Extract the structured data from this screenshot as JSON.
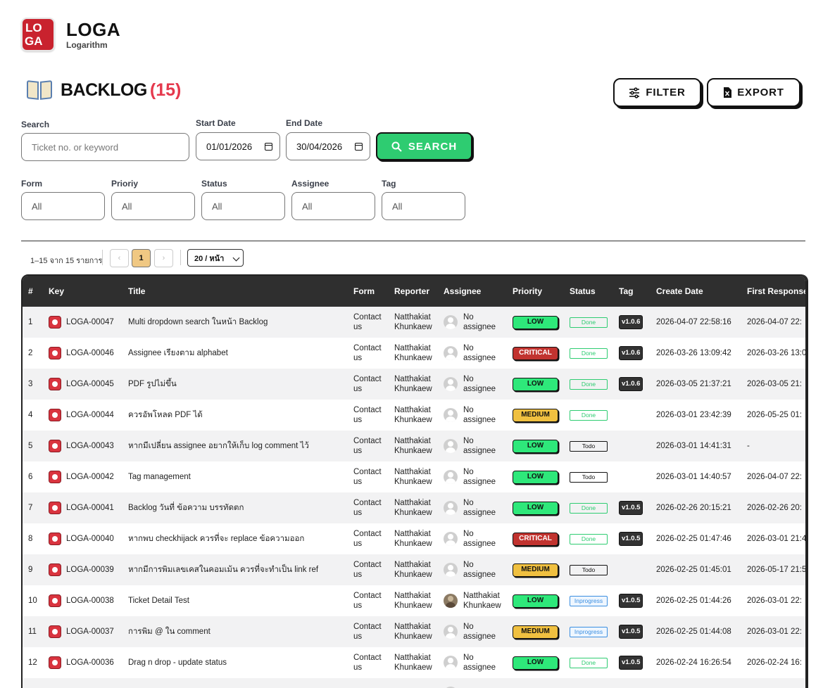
{
  "brand": {
    "logo_letters": [
      "LO",
      "GA"
    ],
    "name": "LOGA",
    "subtitle": "Logarithm"
  },
  "page": {
    "title": "BACKLOG",
    "count": "(15)"
  },
  "actions": {
    "filter_label": "FILTER",
    "export_label": "EXPORT"
  },
  "search": {
    "search_label": "Search",
    "search_placeholder": "Ticket no. or keyword",
    "start_label": "Start Date",
    "start_value": "01/01/2026",
    "end_label": "End Date",
    "end_value": "30/04/2026",
    "button_label": "SEARCH"
  },
  "filters": [
    {
      "label": "Form",
      "value": "All"
    },
    {
      "label": "Prioriy",
      "value": "All"
    },
    {
      "label": "Status",
      "value": "All"
    },
    {
      "label": "Assignee",
      "value": "All"
    },
    {
      "label": "Tag",
      "value": "All"
    }
  ],
  "pagination": {
    "info": "1–15 จาก 15 รายการ",
    "prev": "‹",
    "current": "1",
    "next": "›",
    "page_size": "20 / หน้า"
  },
  "table": {
    "columns": [
      "#",
      "Key",
      "Title",
      "Form",
      "Reporter",
      "Assignee",
      "Priority",
      "Status",
      "Tag",
      "Create Date",
      "First Response"
    ],
    "rows": [
      {
        "n": "1",
        "key": "LOGA-00047",
        "title": "Multi dropdown search ในหน้า Backlog",
        "form": "Contact us",
        "reporter": "Natthakiat Khunkaew",
        "assignee": "No assignee",
        "photo": false,
        "priority": "LOW",
        "status": "Done",
        "tag": "v1.0.6",
        "created": "2026-04-07 22:58:16",
        "first": "2026-04-07 22:"
      },
      {
        "n": "2",
        "key": "LOGA-00046",
        "title": "Assignee เรียงตาม alphabet",
        "form": "Contact us",
        "reporter": "Natthakiat Khunkaew",
        "assignee": "No assignee",
        "photo": false,
        "priority": "CRITICAL",
        "status": "Done",
        "tag": "v1.0.6",
        "created": "2026-03-26 13:09:42",
        "first": "2026-03-26 13:0"
      },
      {
        "n": "3",
        "key": "LOGA-00045",
        "title": "PDF รูปไม่ขึ้น",
        "form": "Contact us",
        "reporter": "Natthakiat Khunkaew",
        "assignee": "No assignee",
        "photo": false,
        "priority": "LOW",
        "status": "Done",
        "tag": "v1.0.6",
        "created": "2026-03-05 21:37:21",
        "first": "2026-03-05 21:"
      },
      {
        "n": "4",
        "key": "LOGA-00044",
        "title": "ควรอัพโหลด PDF ได้",
        "form": "Contact us",
        "reporter": "Natthakiat Khunkaew",
        "assignee": "No assignee",
        "photo": false,
        "priority": "MEDIUM",
        "status": "Done",
        "tag": "",
        "created": "2026-03-01 23:42:39",
        "first": "2026-05-25 01:"
      },
      {
        "n": "5",
        "key": "LOGA-00043",
        "title": "หากมีเปลี่ยน assignee อยากให้เก็บ log comment ไว้",
        "form": "Contact us",
        "reporter": "Natthakiat Khunkaew",
        "assignee": "No assignee",
        "photo": false,
        "priority": "LOW",
        "status": "Todo",
        "tag": "",
        "created": "2026-03-01 14:41:31",
        "first": "-"
      },
      {
        "n": "6",
        "key": "LOGA-00042",
        "title": "Tag management",
        "form": "Contact us",
        "reporter": "Natthakiat Khunkaew",
        "assignee": "No assignee",
        "photo": false,
        "priority": "LOW",
        "status": "Todo",
        "tag": "",
        "created": "2026-03-01 14:40:57",
        "first": "2026-04-07 22:"
      },
      {
        "n": "7",
        "key": "LOGA-00041",
        "title": "Backlog วันที่ ข้อความ บรรทัดตก",
        "form": "Contact us",
        "reporter": "Natthakiat Khunkaew",
        "assignee": "No assignee",
        "photo": false,
        "priority": "LOW",
        "status": "Done",
        "tag": "v1.0.5",
        "created": "2026-02-26 20:15:21",
        "first": "2026-02-26 20:"
      },
      {
        "n": "8",
        "key": "LOGA-00040",
        "title": "หากพบ checkhijack ควรที่จะ replace ข้อความออก",
        "form": "Contact us",
        "reporter": "Natthakiat Khunkaew",
        "assignee": "No assignee",
        "photo": false,
        "priority": "CRITICAL",
        "status": "Done",
        "tag": "v1.0.5",
        "created": "2026-02-25 01:47:46",
        "first": "2026-03-01 21:4"
      },
      {
        "n": "9",
        "key": "LOGA-00039",
        "title": "หากมีการพิมเลขเคสในคอมเม้น ควรที่จะทำเป็น link ref",
        "form": "Contact us",
        "reporter": "Natthakiat Khunkaew",
        "assignee": "No assignee",
        "photo": false,
        "priority": "MEDIUM",
        "status": "Todo",
        "tag": "",
        "created": "2026-02-25 01:45:01",
        "first": "2026-05-17 21:5"
      },
      {
        "n": "10",
        "key": "LOGA-00038",
        "title": "Ticket Detail Test",
        "form": "Contact us",
        "reporter": "Natthakiat Khunkaew",
        "assignee": "Natthakiat Khunkaew",
        "photo": true,
        "priority": "LOW",
        "status": "Inprogress",
        "tag": "v1.0.5",
        "created": "2026-02-25 01:44:26",
        "first": "2026-03-01 22:"
      },
      {
        "n": "11",
        "key": "LOGA-00037",
        "title": "การพิม @ ใน comment",
        "form": "Contact us",
        "reporter": "Natthakiat Khunkaew",
        "assignee": "No assignee",
        "photo": false,
        "priority": "MEDIUM",
        "status": "Inprogress",
        "tag": "v1.0.5",
        "created": "2026-02-25 01:44:08",
        "first": "2026-03-01 22:"
      },
      {
        "n": "12",
        "key": "LOGA-00036",
        "title": "Drag n drop - update status",
        "form": "Contact us",
        "reporter": "Natthakiat Khunkaew",
        "assignee": "No assignee",
        "photo": false,
        "priority": "LOW",
        "status": "Done",
        "tag": "v1.0.5",
        "created": "2026-02-24 16:26:54",
        "first": "2026-02-24 16:"
      },
      {
        "n": "",
        "key": "",
        "title": "",
        "form": "Contact",
        "reporter": "Natthakiat",
        "assignee": "No",
        "photo": false,
        "priority": "",
        "status": "",
        "tag": "",
        "created": "",
        "first": ""
      }
    ]
  },
  "colors": {
    "brand_red": "#c9222e",
    "count_red": "#e5394d",
    "search_green": "#2ecc71",
    "low": "#2ee87a",
    "critical": "#c1332f",
    "medium": "#f0c040",
    "header_dark": "#2f2f2f"
  }
}
